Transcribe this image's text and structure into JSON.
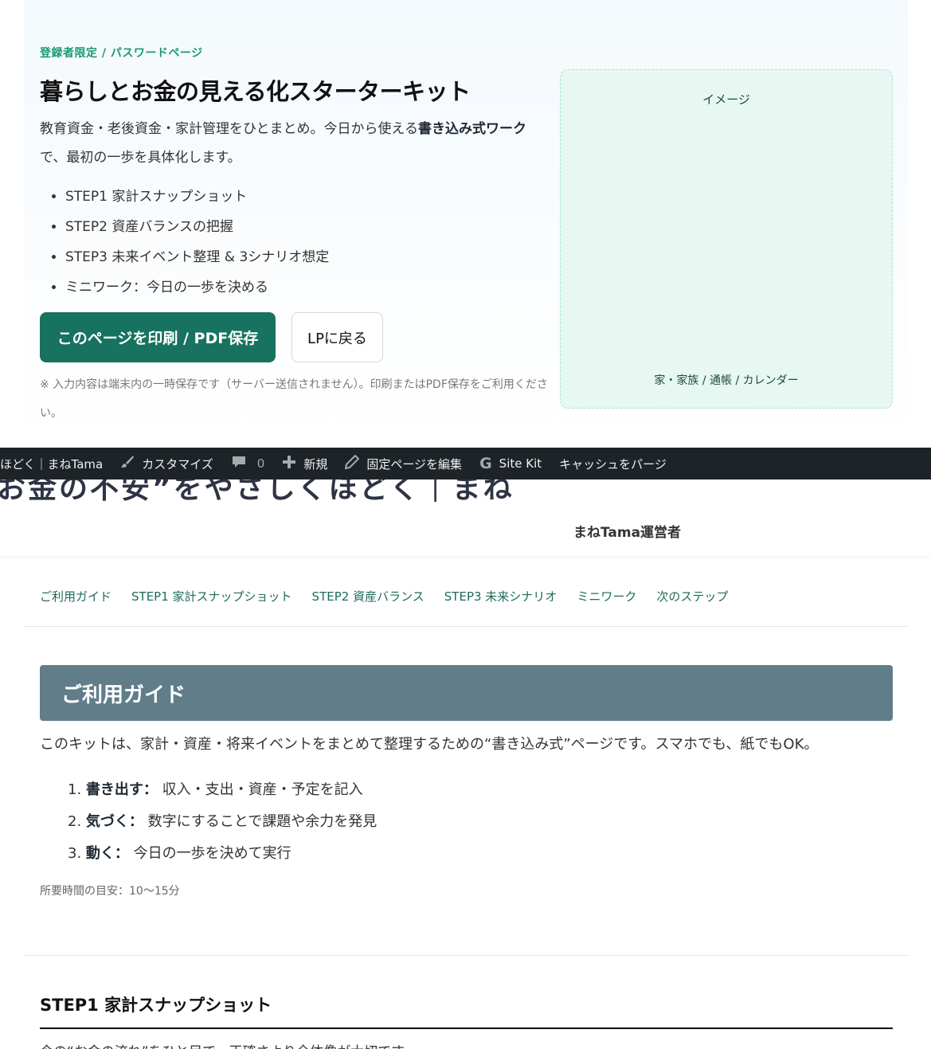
{
  "hero": {
    "kicker": "登録者限定 / パスワードページ",
    "title": "暮らしとお金の見える化スターターキット",
    "lead_before": "教育資金・老後資金・家計管理をひとまとめ。今日から使える",
    "lead_bold": "書き込み式ワーク",
    "lead_after": "で、最初の一歩を具体化します。",
    "steps": [
      "STEP1 家計スナップショット",
      "STEP2 資産バランスの把握",
      "STEP3 未来イベント整理 & 3シナリオ想定",
      "ミニワーク：今日の一歩を決める"
    ],
    "print_button": "このページを印刷 / PDF保存",
    "back_button": "LPに戻る",
    "note": "※ 入力内容は端末内の一時保存です（サーバー送信されません）。印刷またはPDF保存をご利用ください。",
    "image_label": "イメージ",
    "image_caption": "家・家族 / 通帳 / カレンダー"
  },
  "adminbar": {
    "site": "ほどく｜まねTama",
    "customize": "カスタマイズ",
    "comments": "0",
    "new": "新規",
    "edit": "固定ページを編集",
    "sitekit": "Site Kit",
    "purge": "キャッシュをパージ"
  },
  "header": {
    "site_title": "お金の不安”をやさしくほどく｜まね",
    "author": "まねTama運営者"
  },
  "toc": [
    "ご利用ガイド",
    "STEP1 家計スナップショット",
    "STEP2 資産バランス",
    "STEP3 未来シナリオ",
    "ミニワーク",
    "次のステップ"
  ],
  "guide": {
    "heading": "ご利用ガイド",
    "intro": "このキットは、家計・資産・将来イベントをまとめて整理するための“書き込み式”ページです。スマホでも、紙でもOK。",
    "items": [
      {
        "num": "1.",
        "label": "書き出す：",
        "text": "収入・支出・資産・予定を記入"
      },
      {
        "num": "2.",
        "label": "気づく：",
        "text": "数字にすることで課題や余力を発見"
      },
      {
        "num": "3.",
        "label": "動く：",
        "text": "今日の一歩を決めて実行"
      }
    ],
    "time": "所要時間の目安：10〜15分"
  },
  "step1": {
    "title": "STEP1 家計スナップショット",
    "text": "今の“お金の流れ”をひと目で。正確さより全体像が大切です。"
  }
}
